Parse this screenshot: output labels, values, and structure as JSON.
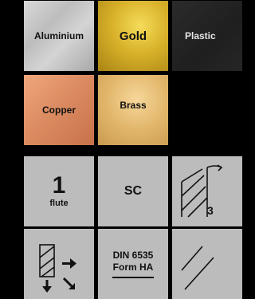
{
  "materials": {
    "aluminium": "Aluminium",
    "gold": "Gold",
    "plastic": "Plastic",
    "copper": "Copper",
    "brass": "Brass"
  },
  "properties": {
    "flutes": {
      "count": "1",
      "label": "flute"
    },
    "coating": "SC",
    "helix_angle_label": "3",
    "shank": {
      "line1": "DIN 6535",
      "line2": "Form HA"
    }
  }
}
